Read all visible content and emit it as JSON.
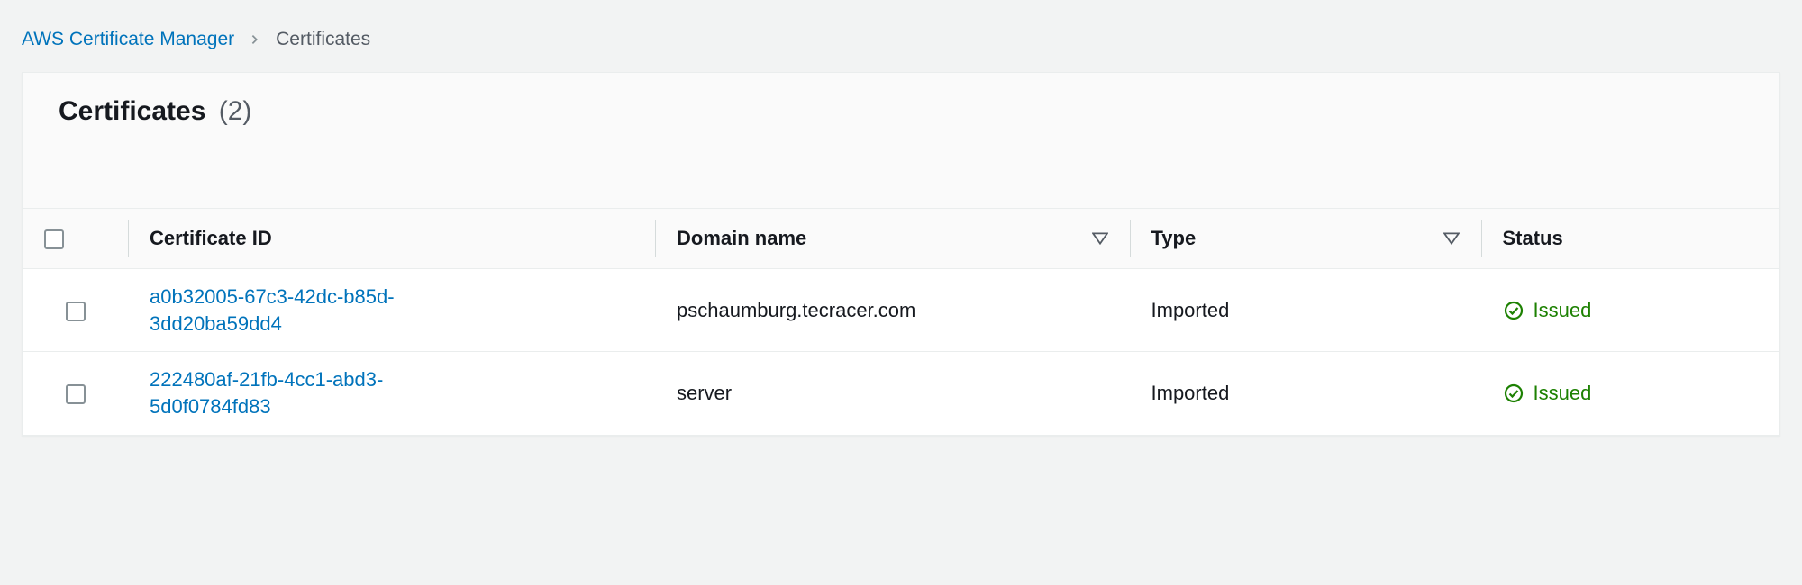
{
  "breadcrumb": {
    "parent": "AWS Certificate Manager",
    "current": "Certificates"
  },
  "panel": {
    "title": "Certificates",
    "count_display": "(2)"
  },
  "columns": {
    "certificate_id": "Certificate ID",
    "domain_name": "Domain name",
    "type": "Type",
    "status": "Status"
  },
  "rows": [
    {
      "id_line1": "a0b32005-67c3-42dc-b85d-",
      "id_line2": "3dd20ba59dd4",
      "domain": "pschaumburg.tecracer.com",
      "type": "Imported",
      "status": "Issued"
    },
    {
      "id_line1": "222480af-21fb-4cc1-abd3-",
      "id_line2": "5d0f0784fd83",
      "domain": "server",
      "type": "Imported",
      "status": "Issued"
    }
  ],
  "colors": {
    "link": "#0073bb",
    "success": "#1d8102"
  }
}
